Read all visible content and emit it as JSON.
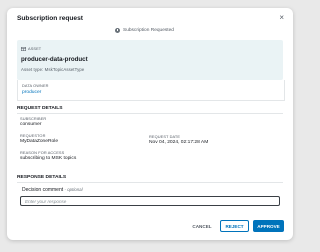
{
  "dialog": {
    "title": "Subscription request",
    "close_glyph": "×",
    "status": "Subscription Requested"
  },
  "asset": {
    "section_label": "ASSET",
    "name": "producer-data-product",
    "type_line": "Asset type: MskTopicAssetType",
    "owner_label": "DATA OWNER",
    "owner_value": "producer"
  },
  "request_details": {
    "heading": "REQUEST DETAILS",
    "subscriber_label": "SUBSCRIBER",
    "subscriber_value": "consumer",
    "requestor_label": "REQUESTOR",
    "requestor_value": "MyDataZoneRole",
    "request_date_label": "REQUEST DATE",
    "request_date_value": "Nov 04, 2024, 02:17:28 AM",
    "reason_label": "REASON FOR ACCESS",
    "reason_value": "subscribing to MSK topics"
  },
  "response_details": {
    "heading": "RESPONSE DETAILS",
    "comment_label": "Decision comment",
    "comment_optional": "- optional",
    "comment_placeholder": "Enter your response",
    "comment_value": ""
  },
  "actions": {
    "cancel_label": "CANCEL",
    "reject_label": "REJECT",
    "approve_label": "APPROVE"
  },
  "colors": {
    "accent": "#0073bb",
    "asset_card_bg": "#eaf3f5"
  },
  "icons": {
    "status": "status-circle-icon",
    "asset": "asset-table-icon",
    "close": "close-icon"
  }
}
